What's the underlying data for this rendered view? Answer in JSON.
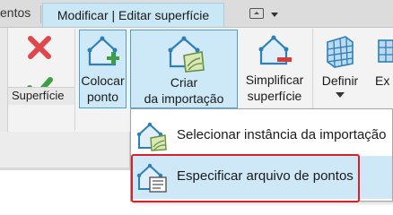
{
  "tabs": {
    "previous_tab_label": "entos",
    "active_tab_label": "Modificar | Editar superfície"
  },
  "ribbon": {
    "panel_label": "Superfície",
    "buttons": {
      "place_point_line1": "Colocar",
      "place_point_line2": "ponto",
      "create_from_import_line1": "Criar",
      "create_from_import_line2": "da importação",
      "simplify_line1": "Simplificar",
      "simplify_line2": "superfície",
      "define_line1": "Definir",
      "extra_line1": "Ex"
    }
  },
  "menu": {
    "items": [
      {
        "label": "Selecionar instância da importação"
      },
      {
        "label": "Especificar arquivo de pontos"
      }
    ]
  },
  "colors": {
    "tab_active_bg": "#c9e7f4",
    "highlight_border": "#4e9fd1",
    "highlight_bg": "#cde8f6",
    "cancel_red": "#e0474c",
    "finish_green": "#3ea043",
    "callout_red": "#d9202a"
  }
}
